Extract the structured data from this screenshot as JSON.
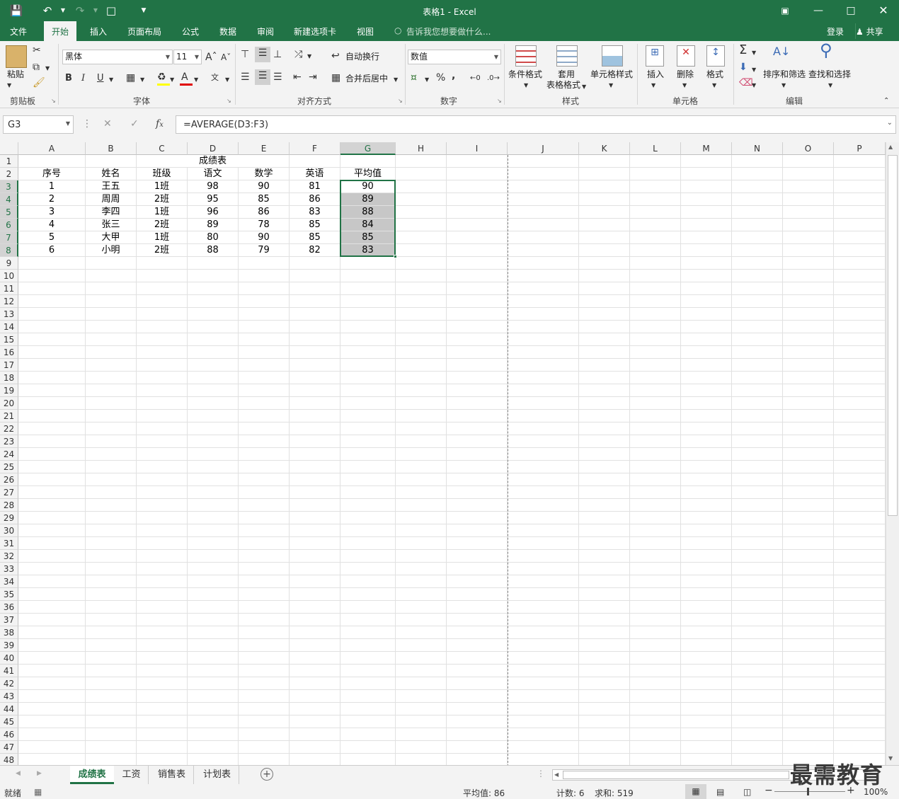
{
  "window": {
    "title": "表格1 - Excel"
  },
  "ribbon_tabs": [
    "文件",
    "开始",
    "插入",
    "页面布局",
    "公式",
    "数据",
    "审阅",
    "新建选项卡",
    "视图"
  ],
  "active_tab": "开始",
  "tell_me": "告诉我您想要做什么...",
  "account": {
    "login": "登录",
    "share": "共享"
  },
  "ribbon": {
    "clipboard": {
      "paste": "粘贴",
      "group": "剪贴板"
    },
    "font": {
      "name": "黑体",
      "size": "11",
      "group": "字体",
      "bold": "B",
      "italic": "I",
      "underline": "U",
      "font_color": "A"
    },
    "alignment": {
      "wrap": "自动换行",
      "merge": "合并后居中",
      "group": "对齐方式"
    },
    "number": {
      "format": "数值",
      "percent": "%",
      "comma": ",",
      "group": "数字"
    },
    "styles": {
      "conditional": "条件格式",
      "table_fmt_1": "套用",
      "table_fmt_2": "表格格式",
      "cell_styles": "单元格样式",
      "group": "样式"
    },
    "cells": {
      "insert": "插入",
      "delete": "删除",
      "format": "格式",
      "group": "单元格"
    },
    "editing": {
      "sort": "排序和筛选",
      "find": "查找和选择",
      "group": "编辑"
    }
  },
  "name_box": "G3",
  "formula": "=AVERAGE(D3:F3)",
  "columns": [
    "A",
    "B",
    "C",
    "D",
    "E",
    "F",
    "G",
    "H",
    "I",
    "J",
    "K",
    "L",
    "M",
    "N",
    "O",
    "P"
  ],
  "selected_column": "G",
  "title_cell": "成绩表",
  "headers": [
    "序号",
    "姓名",
    "班级",
    "语文",
    "数学",
    "英语",
    "平均值"
  ],
  "data_rows": [
    [
      "1",
      "王五",
      "1班",
      "98",
      "90",
      "81",
      "90"
    ],
    [
      "2",
      "周周",
      "2班",
      "95",
      "85",
      "86",
      "89"
    ],
    [
      "3",
      "李四",
      "1班",
      "96",
      "86",
      "83",
      "88"
    ],
    [
      "4",
      "张三",
      "2班",
      "89",
      "78",
      "85",
      "84"
    ],
    [
      "5",
      "大甲",
      "1班",
      "80",
      "90",
      "85",
      "85"
    ],
    [
      "6",
      "小明",
      "2班",
      "88",
      "79",
      "82",
      "83"
    ]
  ],
  "row_count": 48,
  "selected_rows": [
    3,
    4,
    5,
    6,
    7,
    8
  ],
  "sheets": [
    "成绩表",
    "工资",
    "销售表",
    "计划表"
  ],
  "active_sheet": "成绩表",
  "status": {
    "ready": "就绪",
    "average": "平均值: 86",
    "count": "计数: 6",
    "sum": "求和: 519",
    "zoom": "100%"
  },
  "watermark": "最需教育",
  "colors": {
    "brand": "#217346",
    "selection": "#c7c7c7"
  }
}
